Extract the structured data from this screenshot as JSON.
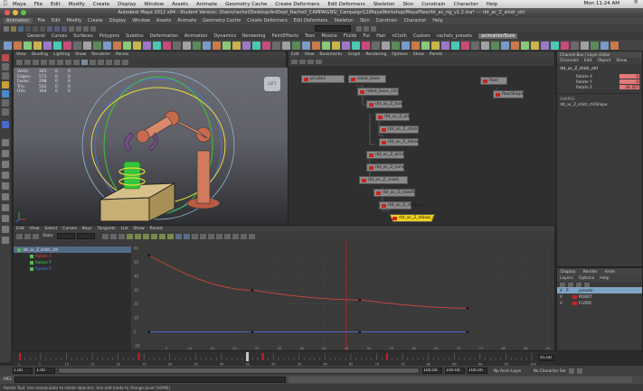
{
  "macmenu": {
    "apple": "",
    "items": [
      "Maya",
      "File",
      "Edit",
      "Modify",
      "Create",
      "Display",
      "Window",
      "Assets",
      "Animate",
      "Geometry Cache",
      "Create Deformers",
      "Edit Deformers",
      "Skeleton",
      "Skin",
      "Constrain",
      "Character",
      "Help"
    ],
    "clock": "Mon 11:24 AM"
  },
  "window": {
    "title": "Autodesk Maya 2012 x64 - Student Version: /Users/rachel/Desktop/ArtDept_Rachel/_CAMPAIGNS/_Campaign12/MayaWorkshop/MayaFiles/rbt_ac_rig_v1.2.ma* --- rbt_ac_Z_shldr_ctrl"
  },
  "mayamenu": {
    "mode": "Animation",
    "items": [
      "File",
      "Edit",
      "Modify",
      "Create",
      "Display",
      "Window",
      "Assets",
      "Animate",
      "Geometry Cache",
      "Create Deformers",
      "Edit Deformers",
      "Skeleton",
      "Skin",
      "Constrain",
      "Character",
      "Help"
    ]
  },
  "shelf": {
    "tabs": [
      "General",
      "Curves",
      "Surfaces",
      "Polygons",
      "Subdivs",
      "Deformation",
      "Animation",
      "Dynamics",
      "Rendering",
      "PaintEffects",
      "Toon",
      "Muscle",
      "Fluids",
      "Fur",
      "Hair",
      "nCloth",
      "Custom",
      "rachels_presets",
      "animationTools"
    ],
    "active_tab": "animationTools"
  },
  "viewport": {
    "menu": [
      "View",
      "Shading",
      "Lighting",
      "Show",
      "Renderer",
      "Panels"
    ],
    "hud": [
      {
        "label": "Verts:",
        "a": "342",
        "b": "0",
        "c": "0"
      },
      {
        "label": "Edges:",
        "a": "573",
        "b": "0",
        "c": "0"
      },
      {
        "label": "Faces:",
        "a": "298",
        "b": "0",
        "c": "0"
      },
      {
        "label": "Tris:",
        "a": "542",
        "b": "0",
        "c": "0"
      },
      {
        "label": "UVs:",
        "a": "364",
        "b": "0",
        "c": "0"
      }
    ],
    "viewcube": "LEFT"
  },
  "hypergraph": {
    "menu": [
      "Edit",
      "View",
      "Bookmarks",
      "Graph",
      "Rendering",
      "Options",
      "Show",
      "Panels"
    ],
    "nodes": [
      {
        "label": "pCube1"
      },
      {
        "label": "robot_base"
      },
      {
        "label": "robot_base_ctrl"
      },
      {
        "label": "rbt_ac_Z_base"
      },
      {
        "label": "rbt_ac_Z_jnt1"
      },
      {
        "label": "rbt_ac_Z_shldr"
      },
      {
        "label": "rbt_ac_Z_elbow"
      },
      {
        "label": "rbt_ac_Z_wrist"
      },
      {
        "label": "rbt_ac_Z_hand"
      },
      {
        "label": "rbt_ac_Z_clawL"
      },
      {
        "label": "rbt_ac_Z_clawR"
      },
      {
        "label": "rbt_ac_Z_shldr_ctrl"
      },
      {
        "label": "rbt_ac_Z_elbow_ctrl"
      },
      {
        "label": "rbt_ac_Z_wrist_ctrl"
      },
      {
        "label": "rbt_ac_Z_shldr_ctrlShape"
      },
      {
        "label": "floor"
      },
      {
        "label": "floorShape"
      }
    ]
  },
  "channelbox": {
    "title": "Channel Box / Layer Editor",
    "menu": [
      "Channels",
      "Edit",
      "Object",
      "Show"
    ],
    "object": "rbt_ac_Z_shldr_ctrl",
    "channels": [
      {
        "name": "Rotate X",
        "value": "0"
      },
      {
        "name": "Rotate Y",
        "value": "0"
      },
      {
        "name": "Rotate Z",
        "value": "34.357"
      }
    ],
    "shapes_label": "SHAPES",
    "shape": "rbt_ac_Z_shldr_ctrlShape"
  },
  "grapheditor": {
    "menu": [
      "Edit",
      "View",
      "Select",
      "Curves",
      "Keys",
      "Tangents",
      "List",
      "Show",
      "Panels"
    ],
    "stats_label": "Stats",
    "outliner": [
      {
        "label": "rbt_ac_Z_shldr_ctrl"
      },
      {
        "label": "Rotate X"
      },
      {
        "label": "Rotate Y"
      },
      {
        "label": "Rotate Z"
      }
    ],
    "y_ticks": [
      "60",
      "50",
      "40",
      "30",
      "20",
      "10",
      "0",
      "-10"
    ],
    "x_ticks": [
      "5",
      "10",
      "15",
      "20",
      "25",
      "30",
      "35",
      "40",
      "45",
      "50",
      "55",
      "60",
      "65",
      "70",
      "75",
      "80",
      "85",
      "90"
    ],
    "current_frame": 45,
    "curves": [
      {
        "name": "Rotate Z",
        "color": "#d0453c",
        "frames": [
          1,
          24,
          48,
          72
        ],
        "values": [
          55,
          30,
          23,
          17
        ]
      },
      {
        "name": "Rotate X",
        "color": "#4a6fd0",
        "frames": [
          1,
          24,
          48,
          72
        ],
        "values": [
          0,
          0,
          0,
          0
        ]
      }
    ]
  },
  "layers": {
    "tabs": [
      "Display",
      "Render",
      "Anim"
    ],
    "menu": [
      "Layers",
      "Options",
      "Help"
    ],
    "rows": [
      {
        "v": "V",
        "p": "P",
        "name": "presets",
        "color": "#7fa3c4"
      },
      {
        "v": "V",
        "p": "",
        "name": "ROBOT",
        "color": "#c8231f"
      },
      {
        "v": "V",
        "p": "",
        "name": "FLOOR",
        "color": "#c8231f"
      }
    ]
  },
  "timeline": {
    "ticks": [
      "1",
      "5",
      "10",
      "15",
      "20",
      "25",
      "30",
      "35",
      "40",
      "45",
      "50",
      "55",
      "60",
      "65",
      "70",
      "75",
      "80",
      "85",
      "90",
      "95",
      "100"
    ],
    "current": "45.00"
  },
  "range": {
    "start": "1.00",
    "inner_start": "1.00",
    "inner_end": "100.00",
    "end": "100.00",
    "end2": "100.00",
    "anim_layer": "No Anim Layer",
    "char_set": "No Character Set"
  },
  "cmdline": {
    "label": "MEL"
  },
  "helpline": {
    "text": "Rotate Tool: Use manipulator to rotate object(s). Use edit mode to change pivot (HOME)."
  },
  "colors": {
    "accent": "#c8231f",
    "selection": "#f2d21b",
    "node": "#8a8a8a"
  }
}
